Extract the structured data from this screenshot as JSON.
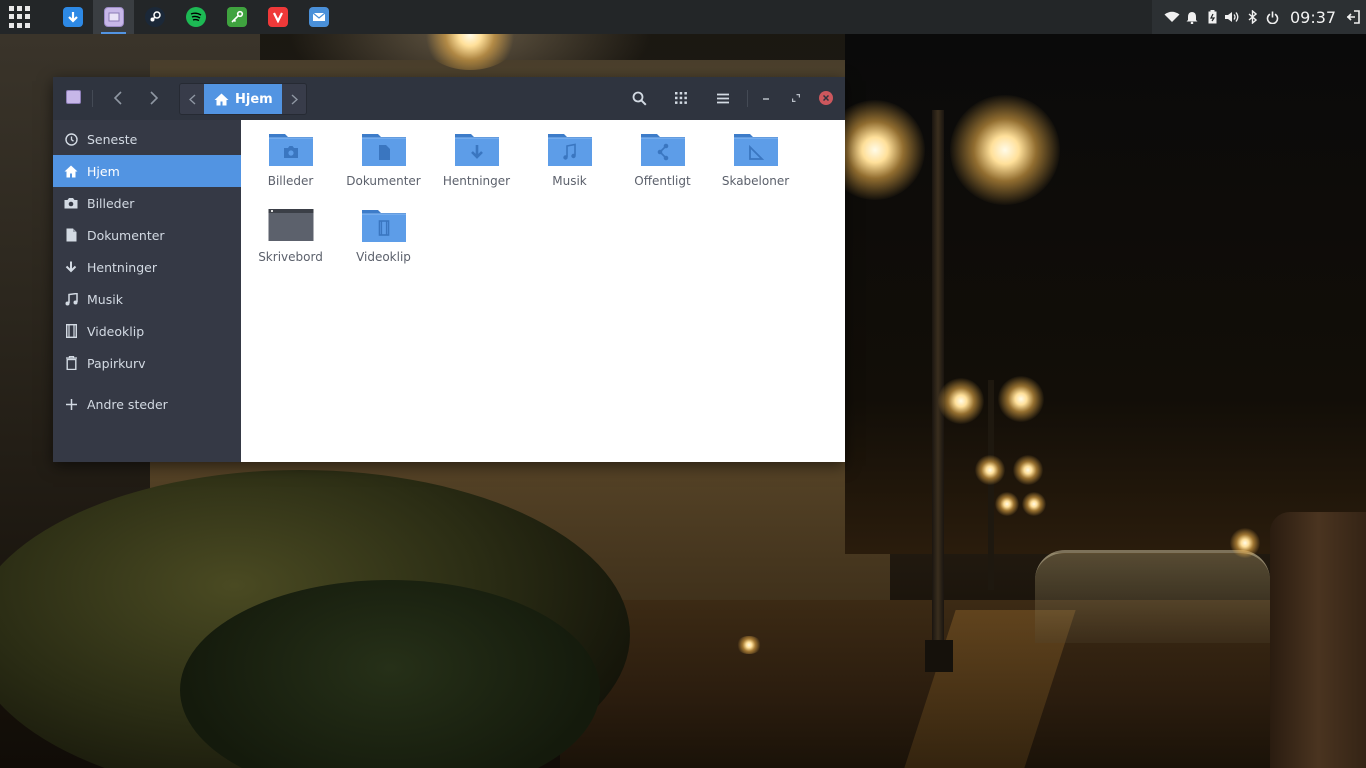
{
  "panel": {
    "apps_button": "applications-grid-icon",
    "dock": [
      {
        "name": "downloader",
        "icon": "download-arrow-icon",
        "color": "#2d89e5"
      },
      {
        "name": "files",
        "icon": "file-manager-icon",
        "color": "#c7b7e8",
        "active": true
      },
      {
        "name": "steam",
        "icon": "steam-icon",
        "color": "#1b2838"
      },
      {
        "name": "spotify",
        "icon": "spotify-icon",
        "color": "#1db954"
      },
      {
        "name": "password-manager",
        "icon": "key-icon",
        "color": "#3fa33f"
      },
      {
        "name": "vivaldi",
        "icon": "vivaldi-icon",
        "color": "#ef3939"
      },
      {
        "name": "mail",
        "icon": "envelope-icon",
        "color": "#4a90d9"
      }
    ],
    "tray_icons": [
      "wifi-icon",
      "notification-bell-icon",
      "battery-icon",
      "volume-icon",
      "bluetooth-icon",
      "power-icon"
    ],
    "clock": "09:37"
  },
  "window": {
    "location": "Hjem",
    "colors": {
      "accent": "#5294e2",
      "headerbar": "#2f343f",
      "sidebar": "#353945",
      "folder": "#5294e2",
      "close": "#cc575d"
    },
    "sidebar": [
      {
        "label": "Seneste",
        "icon": "recent-clock-icon"
      },
      {
        "label": "Hjem",
        "icon": "home-icon",
        "active": true
      },
      {
        "label": "Billeder",
        "icon": "camera-icon"
      },
      {
        "label": "Dokumenter",
        "icon": "document-icon"
      },
      {
        "label": "Hentninger",
        "icon": "download-icon"
      },
      {
        "label": "Musik",
        "icon": "music-note-icon"
      },
      {
        "label": "Videoklip",
        "icon": "film-icon"
      },
      {
        "label": "Papirkurv",
        "icon": "trash-icon"
      },
      {
        "label": "Andre steder",
        "icon": "plus-icon"
      }
    ],
    "files": [
      {
        "label": "Billeder",
        "icon": "folder-pictures-icon"
      },
      {
        "label": "Dokumenter",
        "icon": "folder-documents-icon"
      },
      {
        "label": "Hentninger",
        "icon": "folder-download-icon"
      },
      {
        "label": "Musik",
        "icon": "folder-music-icon"
      },
      {
        "label": "Offentligt",
        "icon": "folder-publicshare-icon"
      },
      {
        "label": "Skabeloner",
        "icon": "folder-templates-icon"
      },
      {
        "label": "Skrivebord",
        "icon": "folder-desktop-icon"
      },
      {
        "label": "Videoklip",
        "icon": "folder-videos-icon"
      }
    ]
  }
}
